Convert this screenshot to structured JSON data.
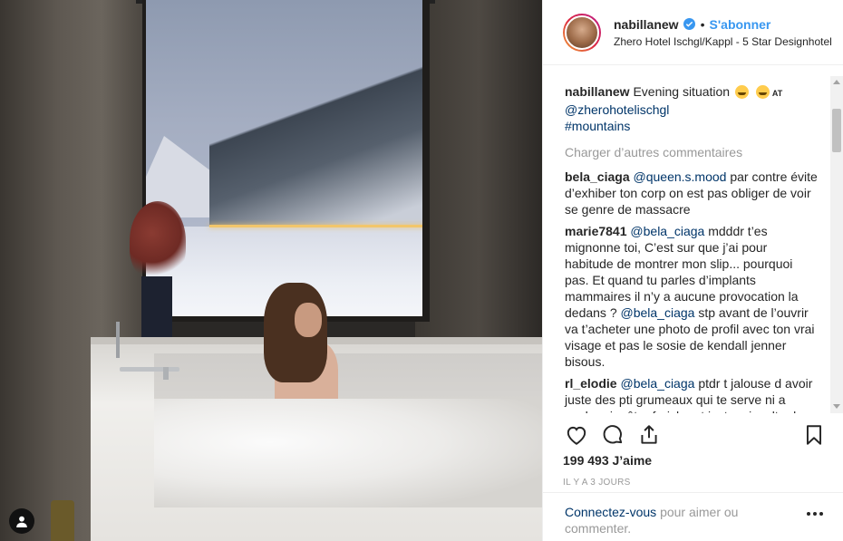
{
  "post": {
    "username": "nabillanew",
    "follow_label": "S'abonner",
    "separator": "•",
    "location": "Zhero Hotel Ischgl/Kappl - 5 Star Designhotel",
    "caption": {
      "username": "nabillanew",
      "text": "Evening situation",
      "at_badge": "AT",
      "mention": "@zherohotelischgl",
      "hashtag": "#mountains"
    },
    "load_more_label": "Charger d’autres commentaires",
    "comments": [
      {
        "username": "bela_ciaga",
        "mention": "@queen.s.mood",
        "text": "par contre évite d’exhiber ton corp on est pas obliger de voir se genre de massacre"
      },
      {
        "username": "marie7841",
        "mention": "@bela_ciaga",
        "text": "mdddr t’es mignonne toi, C’est sur que j’ai pour habitude de montrer mon slip... pourquoi pas. Et quand tu parles d’implants mammaires il n’y a aucune provocation la dedans ?",
        "mention2": "@bela_ciaga",
        "text2": "stp avant de l’ouvrir va t’acheter une photo de profil avec ton vrai visage et pas le sosie de kendall jenner bisous."
      },
      {
        "username": "rl_elodie",
        "mention": "@bela_ciaga",
        "text": "ptdr t jalouse d avoir juste des pti grumeaux qui te serve ni a pecho ni a être fraiche et juste a insulter les"
      }
    ],
    "likes": "199 493 J’aime",
    "time": "IL Y A 3 JOURS",
    "footer": {
      "login_label": "Connectez-vous",
      "rest": "pour aimer ou commenter."
    }
  },
  "icons": {
    "verified": "verified-badge-icon",
    "like": "heart-icon",
    "comment": "comment-icon",
    "share": "share-icon",
    "save": "bookmark-icon",
    "more": "more-options-icon",
    "user": "user-icon"
  },
  "colors": {
    "accent": "#3897f0",
    "link": "#003569",
    "muted": "#999999",
    "text": "#262626"
  }
}
